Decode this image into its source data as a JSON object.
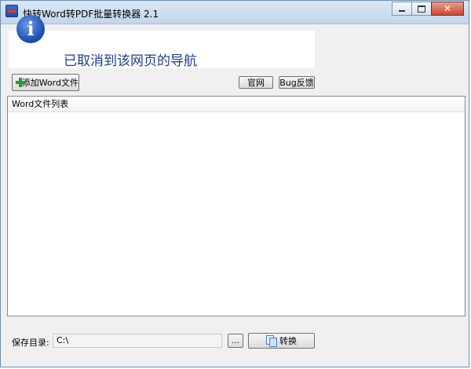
{
  "window": {
    "title": "快转Word转PDF批量转换器 2.1",
    "close_glyph": "✕"
  },
  "banner": {
    "icon": "info-icon",
    "icon_glyph": "i",
    "message": "已取消到该网页的导航"
  },
  "toolbar": {
    "add_word_label": "添加Word文件",
    "official_site_label": "官网",
    "bug_feedback_label": "Bug反馈"
  },
  "file_list": {
    "header": "Word文件列表",
    "rows": []
  },
  "save": {
    "label": "保存目录:",
    "path": "C:\\",
    "browse_label": "...",
    "convert_label": "转换"
  },
  "colors": {
    "banner_text": "#1f3d8c",
    "plus_icon": "#2f9a2f",
    "close_button": "#c9452f"
  }
}
